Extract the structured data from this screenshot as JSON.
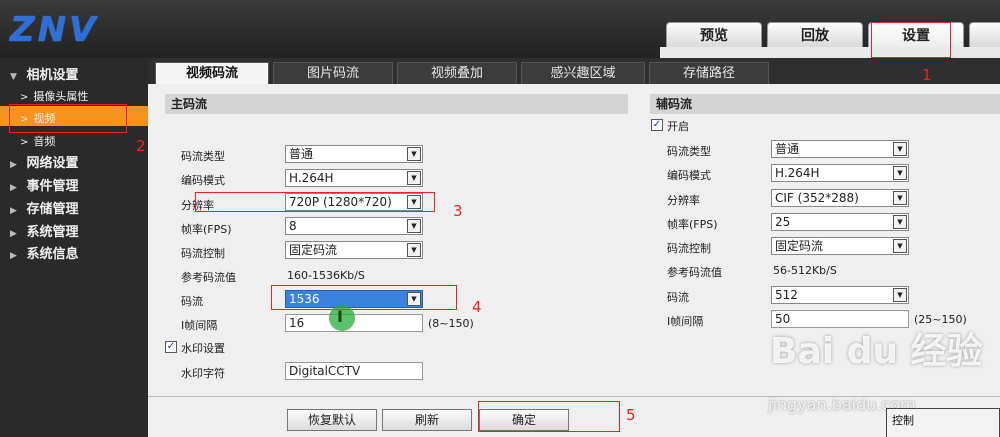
{
  "logo": "ZNV",
  "top_tabs": [
    "预览",
    "回放",
    "设置"
  ],
  "sidebar": {
    "groups": [
      {
        "label": "相机设置",
        "arrow": "▼"
      },
      {
        "label": "网络设置",
        "arrow": "▶"
      },
      {
        "label": "事件管理",
        "arrow": "▶"
      },
      {
        "label": "存储管理",
        "arrow": "▶"
      },
      {
        "label": "系统管理",
        "arrow": "▶"
      },
      {
        "label": "系统信息",
        "arrow": "▶"
      }
    ],
    "sub_items": [
      "摄像头属性",
      "视频",
      "音频"
    ],
    "sub_arrow": ">"
  },
  "sub_tabs": [
    "视频码流",
    "图片码流",
    "视频叠加",
    "感兴趣区域",
    "存储路径"
  ],
  "main_stream": {
    "title": "主码流",
    "labels": {
      "stream_type": "码流类型",
      "encode_mode": "编码模式",
      "resolution": "分辨率",
      "fps": "帧率(FPS)",
      "rate_control": "码流控制",
      "ref_bitrate": "参考码流值",
      "bitrate": "码流",
      "iframe": "I帧间隔"
    },
    "values": {
      "stream_type": "普通",
      "encode_mode": "H.264H",
      "resolution": "720P (1280*720)",
      "fps": "8",
      "rate_control": "固定码流",
      "ref_bitrate": "160-1536Kb/S",
      "bitrate": "1536",
      "iframe": "16",
      "iframe_range": "(8~150)"
    },
    "watermark_label": "水印设置",
    "watermark_text_label": "水印字符",
    "watermark_text": "DigitalCCTV"
  },
  "sub_stream": {
    "title": "辅码流",
    "enable_label": "开启",
    "labels": {
      "stream_type": "码流类型",
      "encode_mode": "编码模式",
      "resolution": "分辨率",
      "fps": "帧率(FPS)",
      "rate_control": "码流控制",
      "ref_bitrate": "参考码流值",
      "bitrate": "码流",
      "iframe": "I帧间隔"
    },
    "values": {
      "stream_type": "普通",
      "encode_mode": "H.264H",
      "resolution": "CIF (352*288)",
      "fps": "25",
      "rate_control": "固定码流",
      "ref_bitrate": "56-512Kb/S",
      "bitrate": "512",
      "iframe": "50",
      "iframe_range": "(25~150)"
    }
  },
  "buttons": {
    "restore": "恢复默认",
    "refresh": "刷新",
    "confirm": "确定"
  },
  "check_mark": "✓",
  "dropdown_glyph": "▼",
  "annotations": [
    "1",
    "2",
    "3",
    "4",
    "5"
  ],
  "watermark_logo": "Bai du 经验",
  "watermark_url": "jingyan.baidu.com",
  "control_panel_title": "控制",
  "colors": {
    "accent_orange": "#f6921e",
    "highlight_blue": "#3b82e0",
    "annotation_red": "#ee2222",
    "logo_blue": "#2f6fd8"
  }
}
